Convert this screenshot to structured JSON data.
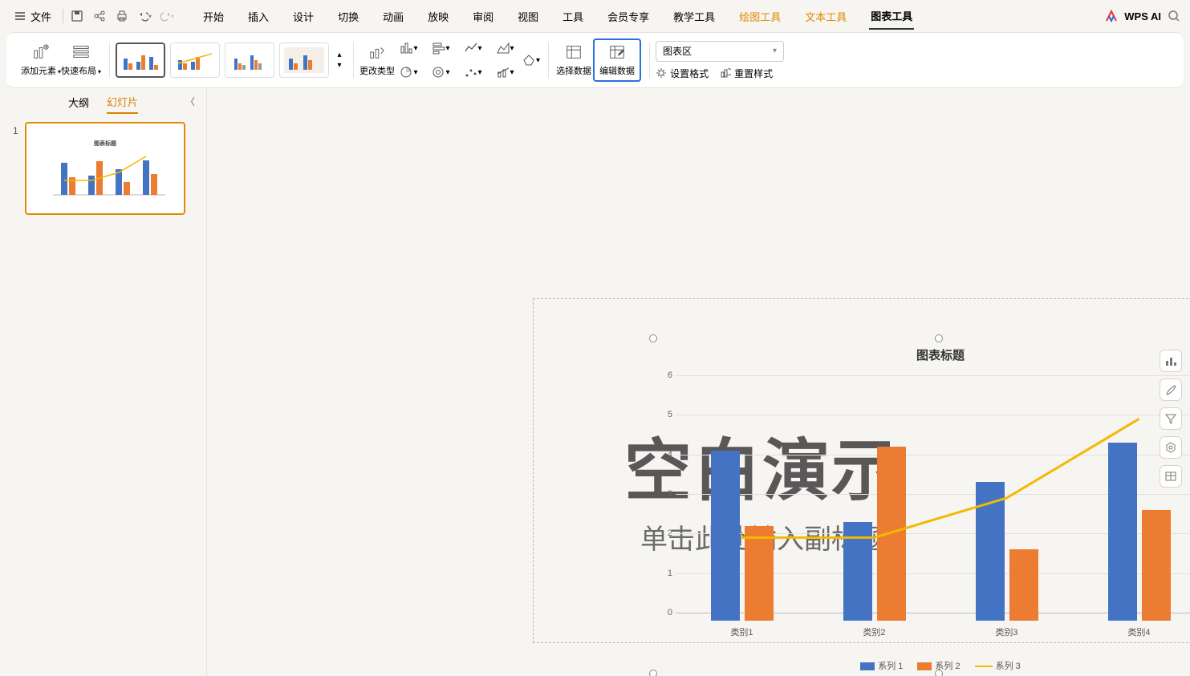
{
  "menu": {
    "file": "文件"
  },
  "tabs": {
    "start": "开始",
    "insert": "插入",
    "design": "设计",
    "transition": "切换",
    "animation": "动画",
    "slideshow": "放映",
    "review": "审阅",
    "view": "视图",
    "tools": "工具",
    "vip": "会员专享",
    "teach": "教学工具",
    "draw": "绘图工具",
    "text": "文本工具",
    "chart": "图表工具"
  },
  "wpsai": "WPS AI",
  "ribbon": {
    "add_element": "添加元素",
    "quick_layout": "快速布局",
    "change_type": "更改类型",
    "select_data": "选择数据",
    "edit_data": "编辑数据",
    "set_format": "设置格式",
    "reset_style": "重置样式",
    "area_selector": "图表区"
  },
  "side": {
    "outline": "大纲",
    "slides": "幻灯片",
    "slide_no": "1"
  },
  "bg": {
    "title": "空白演示",
    "sub": "单击此处输入副标题"
  },
  "chart_data": {
    "type": "bar",
    "title": "图表标题",
    "categories": [
      "类别1",
      "类别2",
      "类别3",
      "类别4"
    ],
    "series": [
      {
        "name": "系列 1",
        "type": "bar",
        "color": "#4573c4",
        "values": [
          4.3,
          2.5,
          3.5,
          4.5
        ]
      },
      {
        "name": "系列 2",
        "type": "bar",
        "color": "#eb7c31",
        "values": [
          2.4,
          4.4,
          1.8,
          2.8
        ]
      },
      {
        "name": "系列 3",
        "type": "line",
        "color": "#f2b900",
        "values": [
          2.0,
          2.0,
          3.0,
          5.0
        ]
      }
    ],
    "ylim": [
      0,
      6
    ],
    "ystep": 1
  },
  "legend": {
    "s1": "系列 1",
    "s2": "系列 2",
    "s3": "系列 3"
  }
}
